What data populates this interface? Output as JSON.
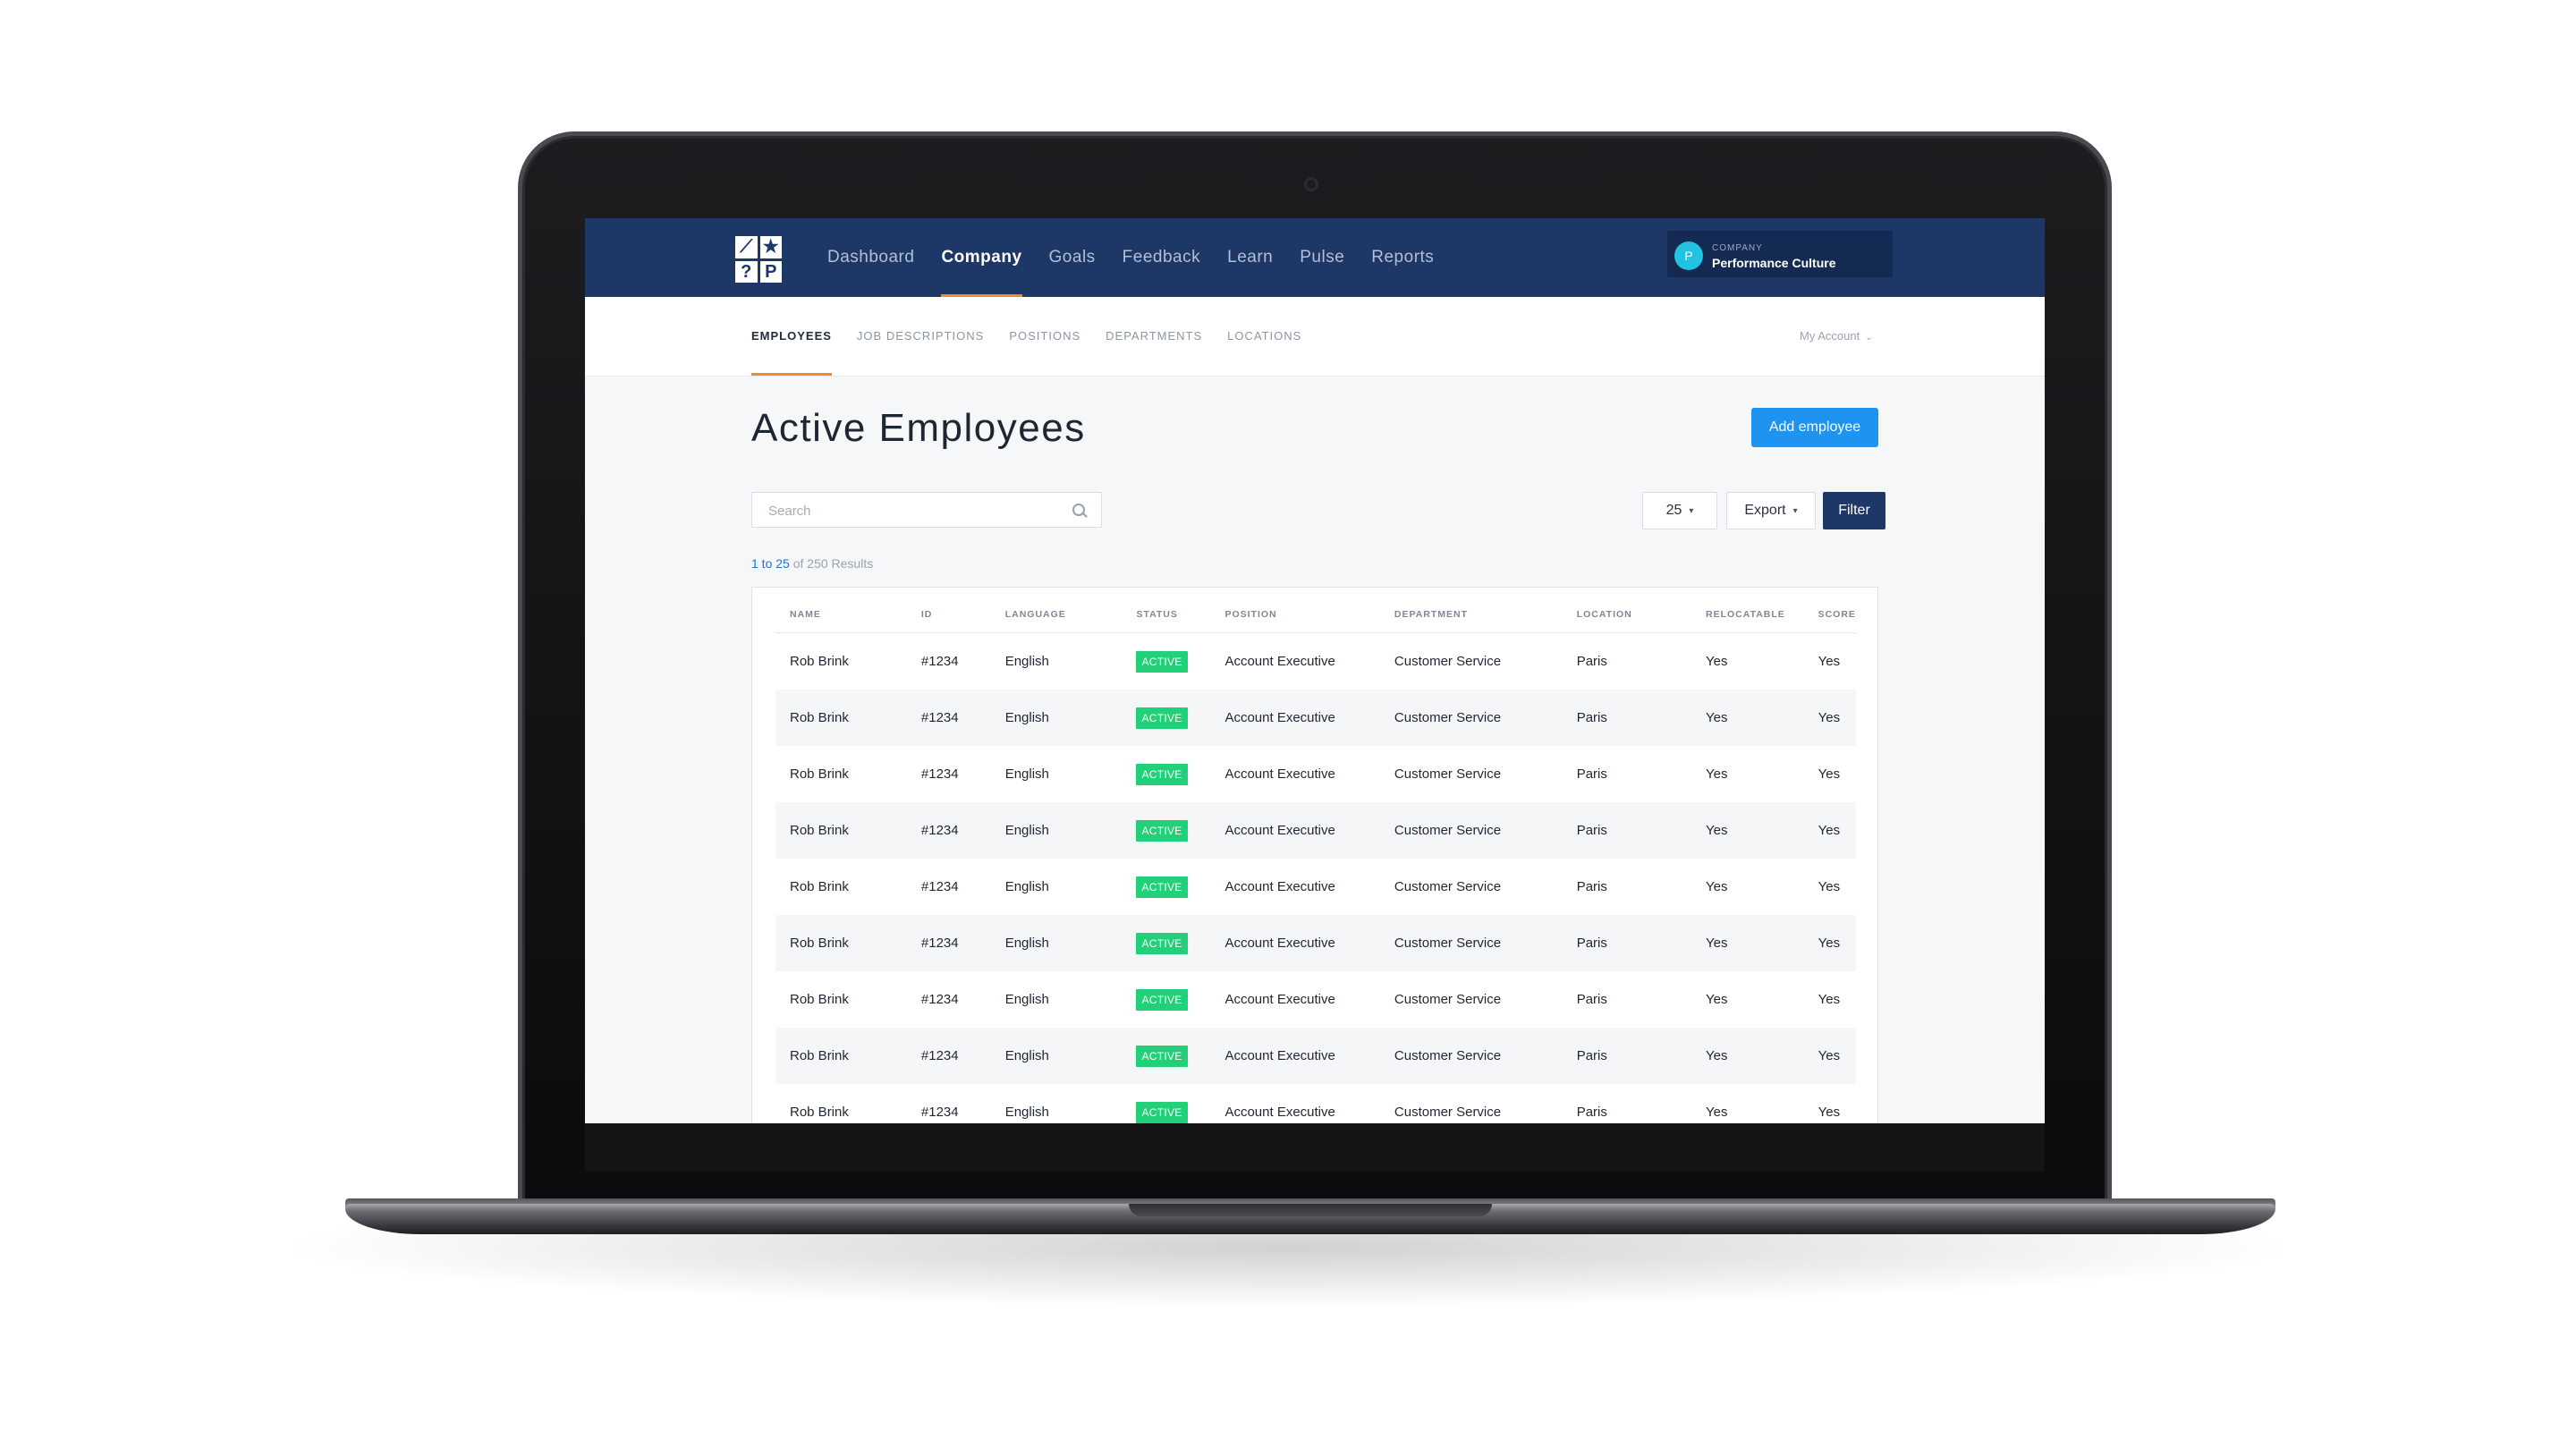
{
  "app": {
    "logo_glyphs": [
      "⟋",
      "★",
      "?",
      "P"
    ],
    "nav": [
      {
        "label": "Dashboard",
        "active": false
      },
      {
        "label": "Company",
        "active": true
      },
      {
        "label": "Goals",
        "active": false
      },
      {
        "label": "Feedback",
        "active": false
      },
      {
        "label": "Learn",
        "active": false
      },
      {
        "label": "Pulse",
        "active": false
      },
      {
        "label": "Reports",
        "active": false
      }
    ],
    "company": {
      "avatar": "P",
      "label": "COMPANY",
      "name": "Performance Culture"
    }
  },
  "subnav": {
    "items": [
      {
        "label": "EMPLOYEES",
        "active": true
      },
      {
        "label": "JOB DESCRIPTIONS",
        "active": false
      },
      {
        "label": "POSITIONS",
        "active": false
      },
      {
        "label": "DEPARTMENTS",
        "active": false
      },
      {
        "label": "LOCATIONS",
        "active": false
      }
    ],
    "account": "My Account"
  },
  "page": {
    "title": "Active Employees",
    "add_button": "Add employee",
    "search_placeholder": "Search",
    "per_page": "25",
    "export_label": "Export",
    "filter_label": "Filter",
    "results_prefix": "1 to 25",
    "results_suffix": "of 250 Results"
  },
  "table": {
    "columns": [
      "NAME",
      "ID",
      "LANGUAGE",
      "STATUS",
      "POSITION",
      "DEPARTMENT",
      "LOCATION",
      "RELOCATABLE",
      "SCORE"
    ],
    "rows": [
      {
        "name": "Rob Brink",
        "id": "#1234",
        "language": "English",
        "status": "ACTIVE",
        "position": "Account Executive",
        "department": "Customer Service",
        "location": "Paris",
        "relocatable": "Yes",
        "score": "Yes"
      },
      {
        "name": "Rob Brink",
        "id": "#1234",
        "language": "English",
        "status": "ACTIVE",
        "position": "Account Executive",
        "department": "Customer Service",
        "location": "Paris",
        "relocatable": "Yes",
        "score": "Yes"
      },
      {
        "name": "Rob Brink",
        "id": "#1234",
        "language": "English",
        "status": "ACTIVE",
        "position": "Account Executive",
        "department": "Customer Service",
        "location": "Paris",
        "relocatable": "Yes",
        "score": "Yes"
      },
      {
        "name": "Rob Brink",
        "id": "#1234",
        "language": "English",
        "status": "ACTIVE",
        "position": "Account Executive",
        "department": "Customer Service",
        "location": "Paris",
        "relocatable": "Yes",
        "score": "Yes"
      },
      {
        "name": "Rob Brink",
        "id": "#1234",
        "language": "English",
        "status": "ACTIVE",
        "position": "Account Executive",
        "department": "Customer Service",
        "location": "Paris",
        "relocatable": "Yes",
        "score": "Yes"
      },
      {
        "name": "Rob Brink",
        "id": "#1234",
        "language": "English",
        "status": "ACTIVE",
        "position": "Account Executive",
        "department": "Customer Service",
        "location": "Paris",
        "relocatable": "Yes",
        "score": "Yes"
      },
      {
        "name": "Rob Brink",
        "id": "#1234",
        "language": "English",
        "status": "ACTIVE",
        "position": "Account Executive",
        "department": "Customer Service",
        "location": "Paris",
        "relocatable": "Yes",
        "score": "Yes"
      },
      {
        "name": "Rob Brink",
        "id": "#1234",
        "language": "English",
        "status": "ACTIVE",
        "position": "Account Executive",
        "department": "Customer Service",
        "location": "Paris",
        "relocatable": "Yes",
        "score": "Yes"
      },
      {
        "name": "Rob Brink",
        "id": "#1234",
        "language": "English",
        "status": "ACTIVE",
        "position": "Account Executive",
        "department": "Customer Service",
        "location": "Paris",
        "relocatable": "Yes",
        "score": "Yes"
      }
    ]
  },
  "colors": {
    "nav_bg": "#1d3766",
    "accent_underline": "#f08b2d",
    "primary_button": "#1e94f0",
    "active_badge": "#22d07a",
    "avatar": "#21c3e0"
  }
}
